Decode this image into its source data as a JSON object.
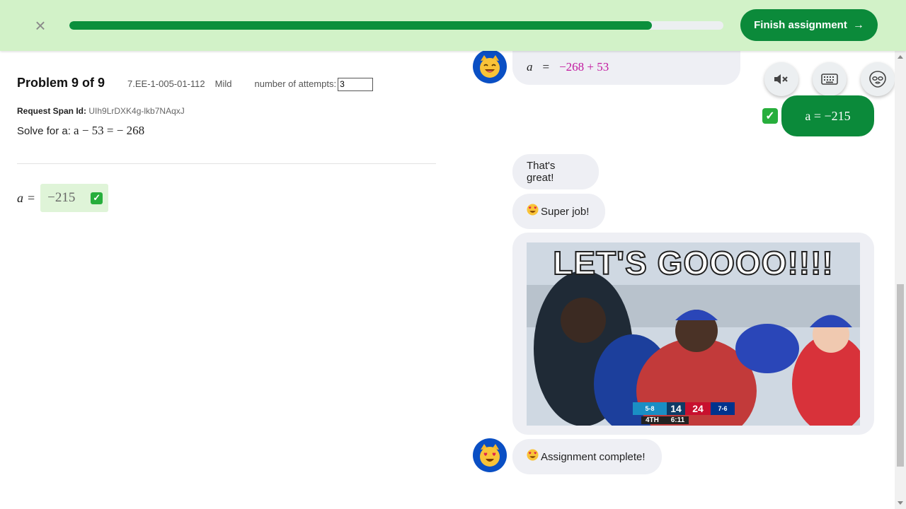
{
  "topbar": {
    "close_glyph": "×",
    "progress_fraction": 0.891,
    "finish_label": "Finish assignment",
    "finish_arrow": "→"
  },
  "problem": {
    "title": "Problem 9 of 9",
    "code": "7.EE-1-005-01-112",
    "level": "Mild",
    "attempts_label": "number of attempts:",
    "attempts_value": "3",
    "span_label": "Request Span Id:",
    "span_id": "UIh9LrDXK4g-lkb7NAqxJ",
    "solve_prefix": "Solve for a:",
    "solve_equation": "a − 53 = − 268"
  },
  "answer": {
    "variable": "a",
    "equals": "=",
    "value": "−215",
    "check_glyph": "✓"
  },
  "chat": {
    "tutor_step_lhs": "a",
    "tutor_step_eq": "=",
    "tutor_step_rhs": "−268 + 53",
    "user_answer": "a = −215",
    "user_check_glyph": "✓",
    "msg_great": "That's great!",
    "msg_super": "Super job!",
    "msg_complete": "Assignment complete!",
    "gif_caption": "LET'S GOOOO!!!!",
    "scorebug": {
      "team1_record": "5-8",
      "score1": "14",
      "score2": "24",
      "team2_record": "7-6",
      "quarter": "4TH",
      "clock": "6:11"
    }
  },
  "icons": {
    "tutor_avatar": "smiling-cat-emoji",
    "tutor_avatar_love": "heart-eyes-cat-emoji",
    "mute": "speaker-mute-icon",
    "keyboard": "keyboard-icon",
    "face": "alien-face-icon"
  },
  "colors": {
    "topbar_bg": "#d2f2c8",
    "accent_green": "#0b8a3a",
    "avatar_blue": "#0a4fc4",
    "bubble_bg": "#eeeff4",
    "math_magenta": "#c2189f"
  }
}
